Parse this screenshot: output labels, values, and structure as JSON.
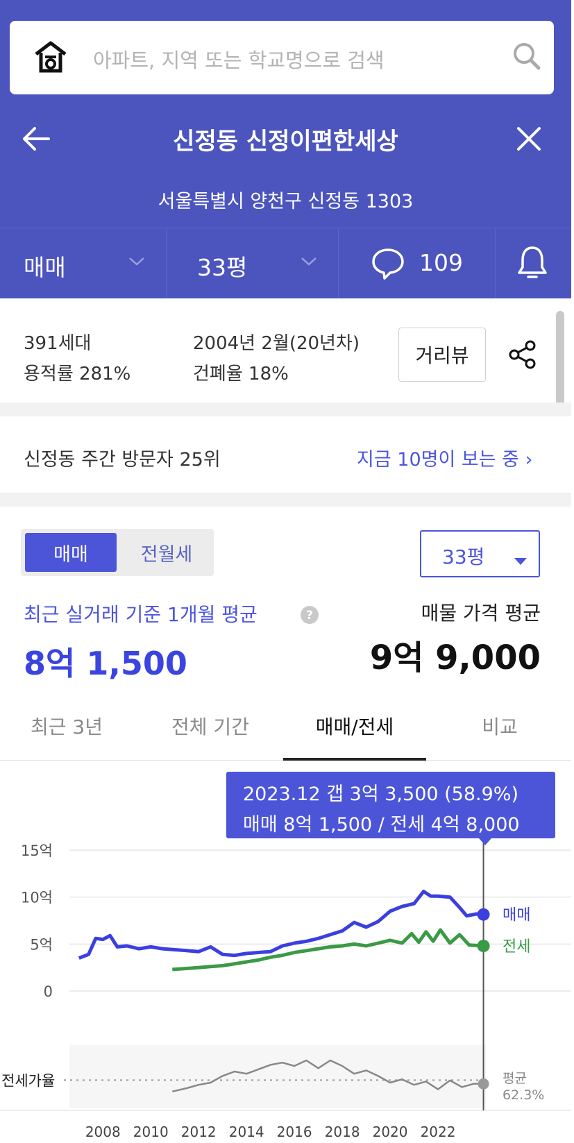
{
  "search": {
    "placeholder": "아파트, 지역 또는 학교명으로 검색"
  },
  "header": {
    "title": "신정동 신정이편한세상",
    "address": "서울특별시 양천구 신정동 1303"
  },
  "tabs": {
    "trade_type": "매매",
    "size": "33평",
    "comment_count": "109"
  },
  "info": {
    "households": "391세대",
    "floor_area_ratio": "용적률 281%",
    "built": "2004년 2월(20년차)",
    "coverage_ratio": "건폐율 18%",
    "street_view": "거리뷰"
  },
  "visitors": {
    "rank": "신정동 주간 방문자 25위",
    "watching": "지금 10명이 보는 중 ›"
  },
  "price": {
    "segment_sale": "매매",
    "segment_rent": "전월세",
    "size_select": "33평",
    "recent_label": "최근 실거래 기준 1개월 평균",
    "recent_value": "8억 1,500",
    "listing_label": "매물 가격 평균",
    "listing_value": "9억 9,000"
  },
  "period_tabs": [
    "최근 3년",
    "전체 기간",
    "매매/전세",
    "비교"
  ],
  "tooltip": {
    "line1": "2023.12  갭 3억 3,500 (58.9%)",
    "line2": "매매 8억 1,500 / 전세 4억 8,000"
  },
  "colors": {
    "accent": "#4c55be",
    "sale": "#3b3fe0",
    "jeonse": "#3a9a46",
    "ratio": "#888888"
  },
  "chart_data": {
    "type": "line",
    "ylabels": [
      "15억",
      "10억",
      "5억",
      "0"
    ],
    "ylim": [
      0,
      15
    ],
    "xticks": [
      "2008",
      "2010",
      "2012",
      "2014",
      "2016",
      "2018",
      "2020",
      "2022"
    ],
    "series": [
      {
        "name": "매매",
        "x": [
          2007.0,
          2007.4,
          2007.7,
          2008.0,
          2008.3,
          2008.6,
          2009.0,
          2009.5,
          2010.0,
          2010.5,
          2011.0,
          2011.5,
          2012.0,
          2012.5,
          2013.0,
          2013.5,
          2014.0,
          2014.5,
          2015.0,
          2015.5,
          2016.0,
          2016.5,
          2017.0,
          2017.5,
          2018.0,
          2018.5,
          2019.0,
          2019.5,
          2020.0,
          2020.5,
          2021.0,
          2021.4,
          2021.7,
          2022.0,
          2022.5,
          2022.9,
          2023.2,
          2023.6,
          2023.9
        ],
        "values": [
          3.5,
          3.9,
          5.6,
          5.5,
          5.9,
          4.7,
          4.8,
          4.5,
          4.7,
          4.5,
          4.4,
          4.3,
          4.2,
          4.7,
          3.9,
          3.8,
          4.0,
          4.1,
          4.2,
          4.8,
          5.1,
          5.3,
          5.6,
          6.0,
          6.4,
          7.3,
          6.8,
          7.4,
          8.5,
          9.0,
          9.3,
          10.6,
          10.1,
          10.1,
          10.0,
          8.9,
          8.0,
          8.2,
          8.15
        ]
      },
      {
        "name": "전세",
        "x": [
          2010.9,
          2011.5,
          2012.0,
          2012.5,
          2013.0,
          2013.5,
          2014.0,
          2014.5,
          2015.0,
          2015.5,
          2016.0,
          2016.5,
          2017.0,
          2017.5,
          2018.0,
          2018.5,
          2019.0,
          2019.5,
          2020.0,
          2020.5,
          2020.9,
          2021.2,
          2021.5,
          2021.8,
          2022.1,
          2022.5,
          2022.9,
          2023.3,
          2023.9
        ],
        "values": [
          2.3,
          2.4,
          2.5,
          2.6,
          2.7,
          2.9,
          3.1,
          3.3,
          3.6,
          3.8,
          4.1,
          4.3,
          4.5,
          4.7,
          4.8,
          5.0,
          4.8,
          5.1,
          5.4,
          5.1,
          6.1,
          5.2,
          6.3,
          5.3,
          6.5,
          5.1,
          6.0,
          4.9,
          4.8
        ]
      },
      {
        "name": "전세가율",
        "x": [
          2010.9,
          2011.5,
          2012.0,
          2012.5,
          2013.0,
          2013.5,
          2014.0,
          2014.5,
          2015.0,
          2015.5,
          2016.0,
          2016.5,
          2017.0,
          2017.5,
          2018.0,
          2018.5,
          2019.0,
          2019.5,
          2020.0,
          2020.5,
          2021.0,
          2021.5,
          2022.0,
          2022.5,
          2023.0,
          2023.5,
          2023.9
        ],
        "values": [
          52,
          55,
          58,
          60,
          66,
          70,
          68,
          72,
          76,
          78,
          75,
          80,
          73,
          80,
          75,
          68,
          71,
          66,
          60,
          63,
          58,
          61,
          54,
          62,
          56,
          59,
          58.9
        ]
      }
    ],
    "legend": [
      "매매",
      "전세"
    ],
    "ratio_label": "전세가율",
    "ratio_avg_label": "평균",
    "ratio_avg_value": "62.3%",
    "ratio_avg": 62.3,
    "ratio_ylim": [
      40,
      90
    ],
    "selected_x": 2023.9
  }
}
